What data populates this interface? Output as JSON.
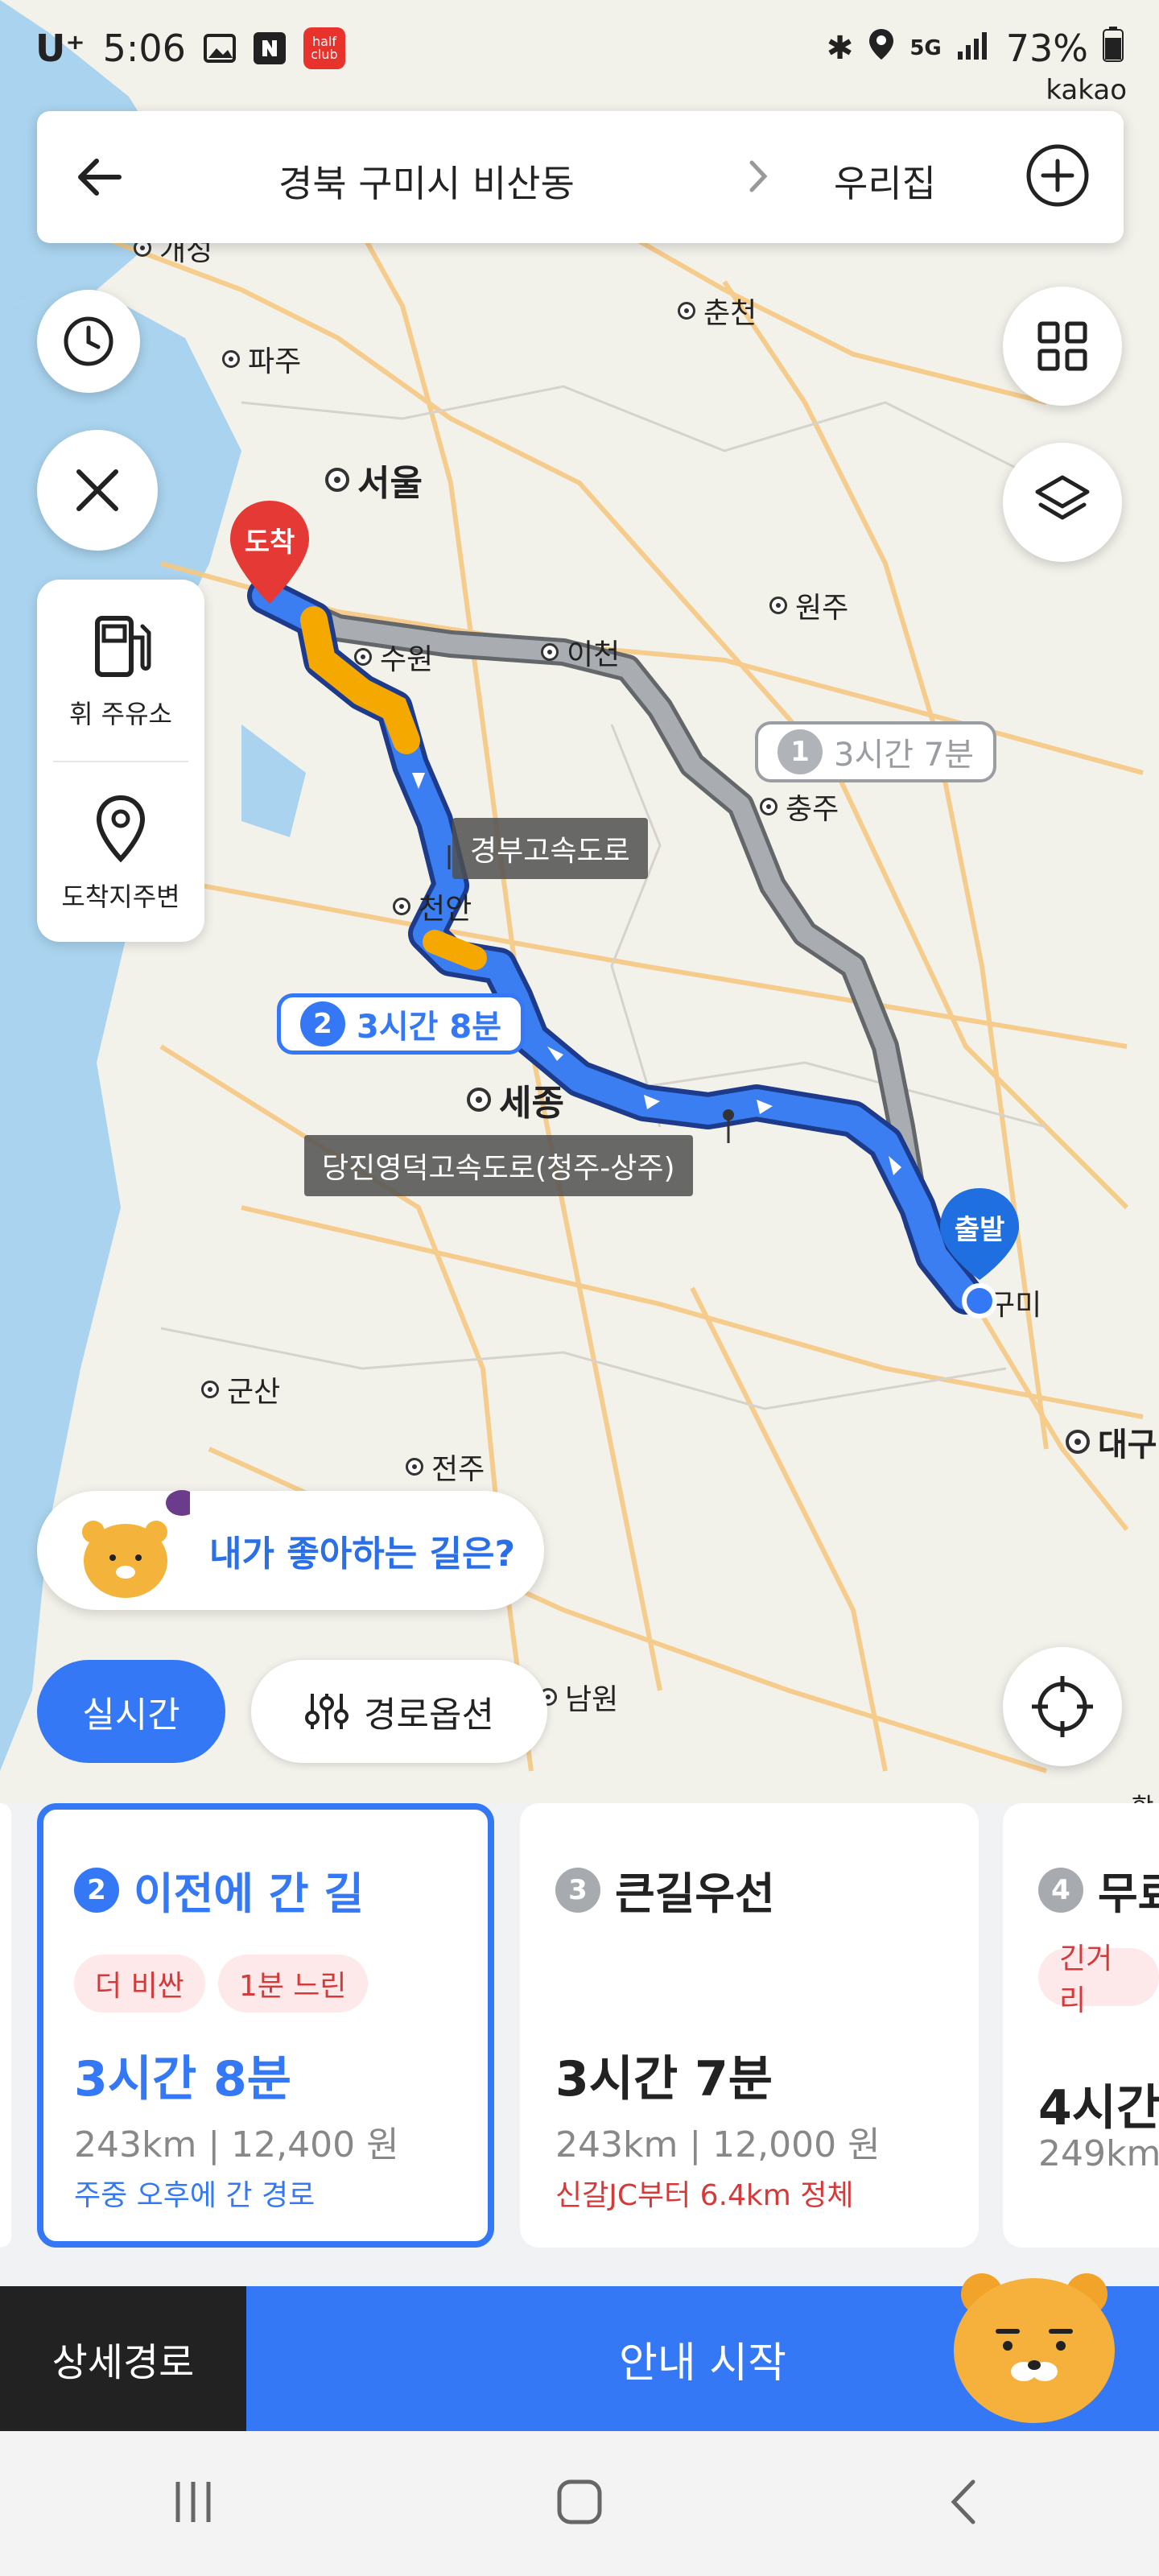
{
  "status_bar": {
    "carrier": "U⁺",
    "time": "5:06",
    "half_club_label": "half club",
    "network": "5G",
    "battery": "73%"
  },
  "brand": "kakao",
  "header": {
    "from": "경북 구미시 비산동",
    "to": "우리집"
  },
  "map": {
    "cities": {
      "gaeseong": "개성",
      "paju": "파주",
      "chuncheon": "춘천",
      "seoul": "서울",
      "suwon": "수원",
      "icheon": "이천",
      "wonju": "원주",
      "chungju": "충주",
      "cheonan": "천안",
      "sejong": "세종",
      "gunsan": "군산",
      "jeonju": "전주",
      "namwon": "남원",
      "daegu": "대구",
      "gumi": "구미",
      "hamyang": "함양"
    },
    "pins": {
      "destination": "도착",
      "origin": "출발"
    },
    "route_labels": {
      "route1_num": "1",
      "route1_time": "3시간 7분",
      "route2_num": "2",
      "route2_time": "3시간 8분"
    },
    "road_labels": {
      "gyeongbu": "경부고속도로",
      "dangjin": "당진영덕고속도로(청주-상주)"
    }
  },
  "side_tools": {
    "gas_label": "휘 주유소",
    "around_label": "도착지주변"
  },
  "favorite_prompt": "내가 좋아하는 길은?",
  "filters": {
    "realtime": "실시간",
    "options": "경로옵션"
  },
  "cards": [
    {
      "num": "2",
      "title": "이전에 간 길",
      "tags": [
        "더 비싼",
        "1분 느린"
      ],
      "time": "3시간 8분",
      "distance": "243km",
      "cost": "12,400 원",
      "note": "주중 오후에 간 경로"
    },
    {
      "num": "3",
      "title": "큰길우선",
      "time": "3시간 7분",
      "distance": "243km",
      "cost": "12,000 원",
      "note": "신갈JC부터 6.4km 정체"
    },
    {
      "num": "4",
      "title": "무료",
      "tags": [
        "긴거리"
      ],
      "time": "4시간",
      "distance": "249km"
    }
  ],
  "actions": {
    "detail": "상세경로",
    "start": "안내 시작"
  },
  "colors": {
    "accent": "#3478f6",
    "route_gray": "#8e9296",
    "traffic": "#f5a800",
    "dest_pin": "#e53935"
  }
}
